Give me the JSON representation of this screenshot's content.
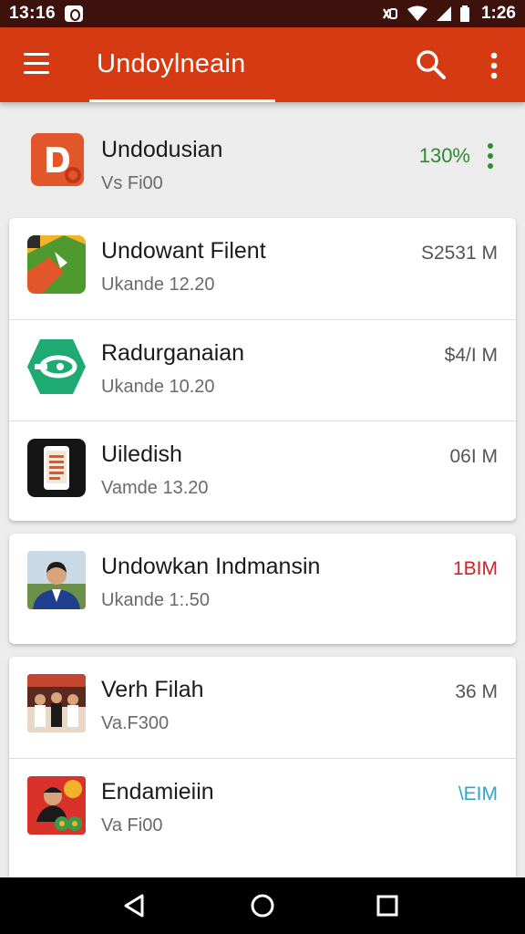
{
  "status_bar": {
    "time": "13:16",
    "clock": "1:26"
  },
  "app_bar": {
    "title": "Undoylneain"
  },
  "header_item": {
    "title": "Undodusian",
    "subtitle": "Vs Fi00",
    "value": "130%",
    "value_color": "#2e8b2e",
    "icon": "app-logo-d-icon"
  },
  "cards": [
    {
      "rows": [
        {
          "title": "Undowant Filent",
          "subtitle": "Ukande 12.20",
          "size": "S2531 M",
          "size_color": "#555555",
          "icon": "game-map-icon"
        },
        {
          "title": "Radurganaian",
          "subtitle": "Ukande 10.20",
          "size": "$4/I M",
          "size_color": "#555555",
          "icon": "green-eye-icon"
        },
        {
          "title": "Uiledish",
          "subtitle": "Vamde 13.20",
          "size": "06I M",
          "size_color": "#555555",
          "icon": "phone-document-icon"
        }
      ]
    },
    {
      "rows": [
        {
          "title": "Undowkan Indmansin",
          "subtitle": "Ukande 1:.50",
          "size": "1BIM",
          "size_color": "#d32020",
          "icon": "person-photo-icon"
        }
      ]
    },
    {
      "rows": [
        {
          "title": "Verh Filah",
          "subtitle": "Va.F300",
          "size": "36 M",
          "size_color": "#555555",
          "icon": "group-photo-icon"
        },
        {
          "title": "Endamieiin",
          "subtitle": "Va Fi00",
          "size": "\\EIM",
          "size_color": "#2aa7c9",
          "icon": "character-art-icon"
        }
      ]
    }
  ]
}
